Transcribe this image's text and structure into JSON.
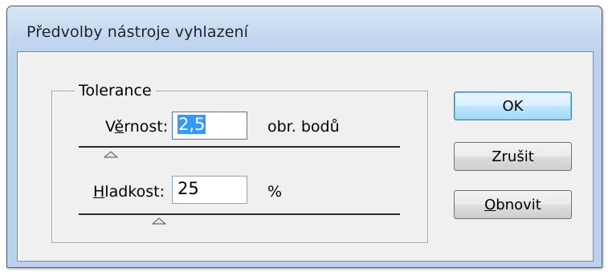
{
  "window": {
    "title": "Předvolby nástroje vyhlazení"
  },
  "tolerance_group": {
    "legend": "Tolerance",
    "fidelity": {
      "label_pre": "V",
      "label_mnemonic": "ě",
      "label_post": "rnost:",
      "value": "2,5",
      "unit": "obr. bodů",
      "slider_fraction": 0.1
    },
    "smoothness": {
      "label_mnemonic": "H",
      "label_post": "ladkost:",
      "value": "25",
      "unit": "%",
      "slider_fraction": 0.25
    }
  },
  "buttons": {
    "ok": "OK",
    "cancel": "Zrušit",
    "reset_mnemonic": "O",
    "reset_post": "bnovit"
  },
  "colors": {
    "selection": "#3399ff",
    "default_button_border": "#3c7fb1"
  }
}
